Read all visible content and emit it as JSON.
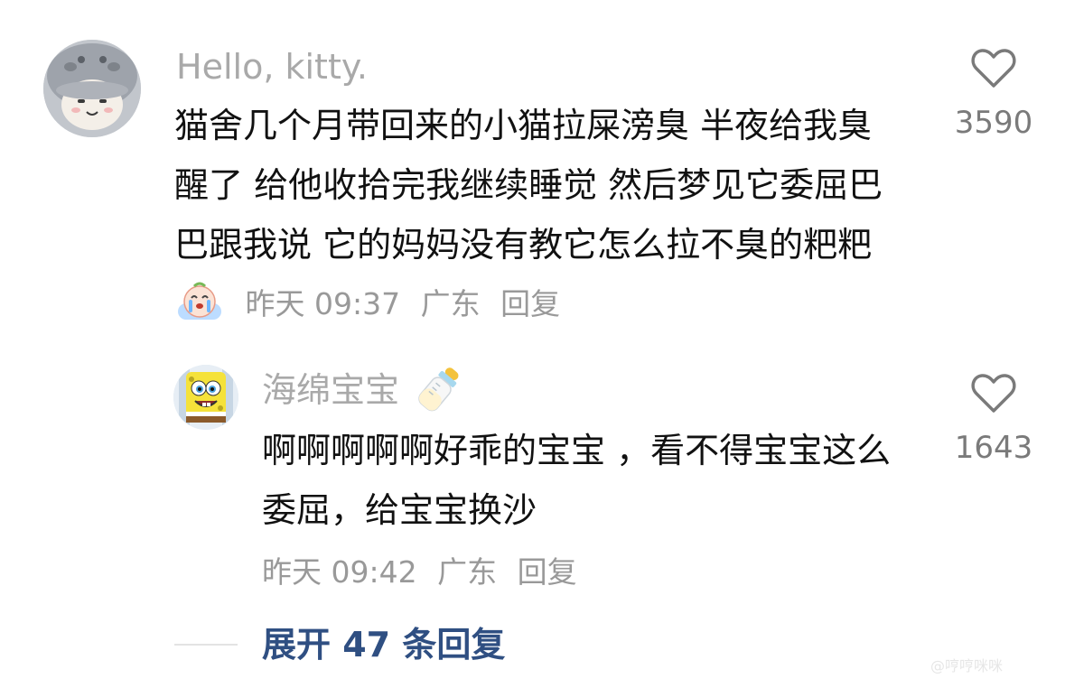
{
  "comment": {
    "username": "Hello, kitty.",
    "text": "猫舍几个月带回来的小猫拉屎滂臭 半夜给我臭醒了 给他收拾完我继续睡觉 然后梦见它委屈巴巴跟我说 它的妈妈没有教它怎么拉不臭的粑粑",
    "emoji": "crying-face-emoji",
    "time": "昨天 09:37",
    "location": "广东",
    "reply_label": "回复",
    "likes": "3590"
  },
  "reply": {
    "username": "海绵宝宝",
    "badge": "baby-bottle-icon",
    "text": "啊啊啊啊啊好乖的宝宝 ，看不得宝宝这么委屈，给宝宝换沙",
    "time": "昨天 09:42",
    "location": "广东",
    "reply_label": "回复",
    "likes": "1643"
  },
  "expand": {
    "label": "展开 47 条回复"
  },
  "watermark": {
    "text": "@哼哼咪咪"
  },
  "colors": {
    "body_text": "#111111",
    "username": "#a9a9a9",
    "meta": "#999999",
    "expand": "#2f4f82"
  }
}
